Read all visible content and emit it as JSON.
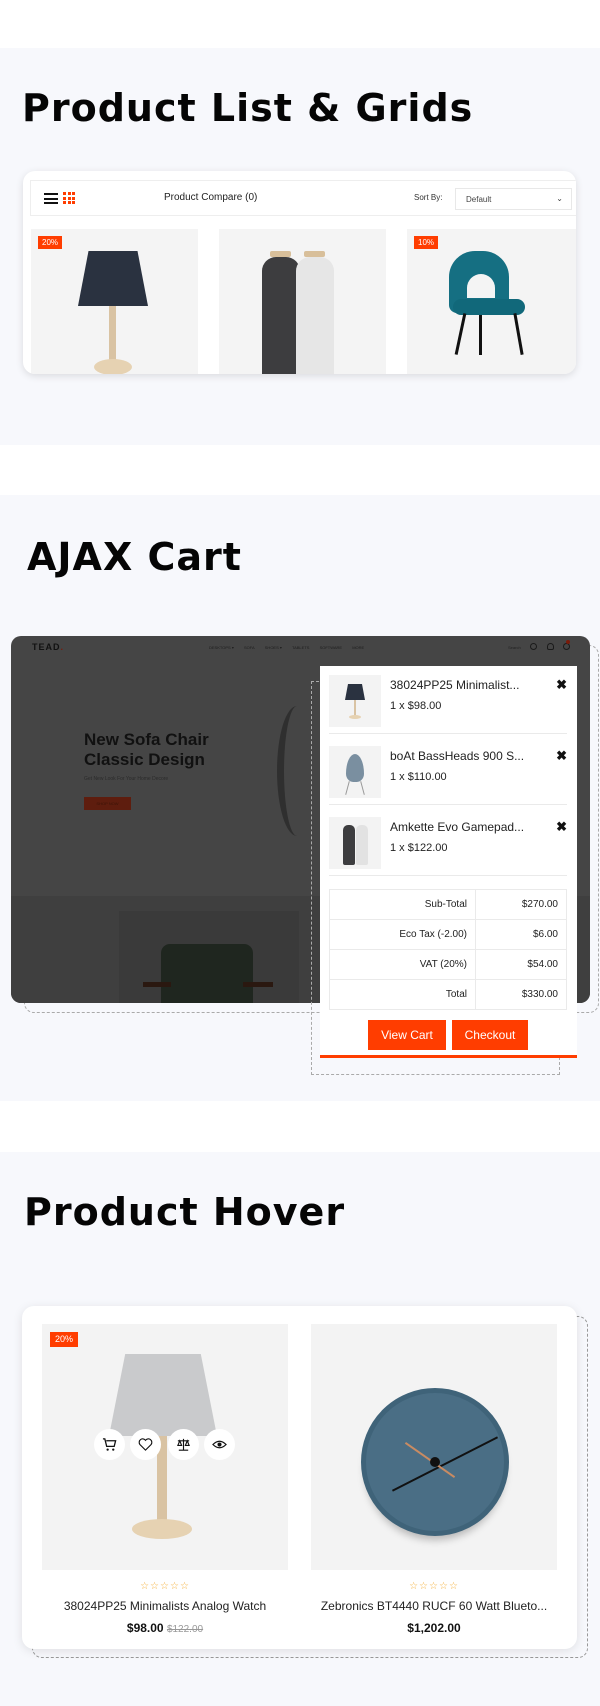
{
  "sections": {
    "list": {
      "title": "Product List & Grids"
    },
    "cart": {
      "title": "AJAX Cart"
    },
    "hover": {
      "title": "Product Hover"
    }
  },
  "product_list": {
    "toolbar": {
      "view_icons": [
        "list-view-icon",
        "grid-view-icon"
      ],
      "compare_label": "Product Compare (0)",
      "sort_label": "Sort By:",
      "sort_value": "Default"
    },
    "products": [
      {
        "image": "table-lamp",
        "badge": "20%"
      },
      {
        "image": "grinder-bottles",
        "badge": ""
      },
      {
        "image": "teal-chair",
        "badge": "10%"
      }
    ]
  },
  "store_preview": {
    "logo": "TEAD",
    "logo_dot": ".",
    "nav": [
      "DESKTOPS ▾",
      "SOFA",
      "SHOES ▾",
      "TABLETS",
      "SOFTWARE",
      "MORE"
    ],
    "search_placeholder": "Search",
    "hero_title_1": "New Sofa Chair",
    "hero_title_2": "Classic Design",
    "hero_subtitle": "Get New Look For Your Home Decore",
    "hero_button": "SHOP NOW"
  },
  "cart": {
    "items": [
      {
        "name": "38024PP25 Minimalist...",
        "qty_price": "1 x $98.00",
        "image": "table-lamp"
      },
      {
        "name": "boAt BassHeads 900 S...",
        "qty_price": "1 x $110.00",
        "image": "drop-chair"
      },
      {
        "name": "Amkette Evo Gamepad...",
        "qty_price": "1 x $122.00",
        "image": "grinder-bottles"
      }
    ],
    "remove_glyph": "✖",
    "totals": [
      {
        "label": "Sub-Total",
        "value": "$270.00"
      },
      {
        "label": "Eco Tax (-2.00)",
        "value": "$6.00"
      },
      {
        "label": "VAT (20%)",
        "value": "$54.00"
      },
      {
        "label": "Total",
        "value": "$330.00"
      }
    ],
    "view_cart_label": "View Cart",
    "checkout_label": "Checkout"
  },
  "hover_products": [
    {
      "badge": "20%",
      "image": "grey-table-lamp",
      "stars": "☆☆☆☆☆",
      "rating": 0,
      "name": "38024PP25 Minimalists Analog Watch",
      "price": "$98.00",
      "old_price": "$122.00",
      "actions": [
        "add-to-cart",
        "wishlist",
        "compare",
        "quick-view"
      ]
    },
    {
      "badge": "",
      "image": "blue-wall-clock",
      "stars": "☆☆☆☆☆",
      "rating": 0,
      "name": "Zebronics BT4440 RUCF 60 Watt Blueto...",
      "price": "$1,202.00",
      "old_price": ""
    }
  ],
  "colors": {
    "accent": "#ff3d00",
    "band": "#f7f8fc",
    "star": "#f5b342",
    "overlay": "#454545"
  }
}
